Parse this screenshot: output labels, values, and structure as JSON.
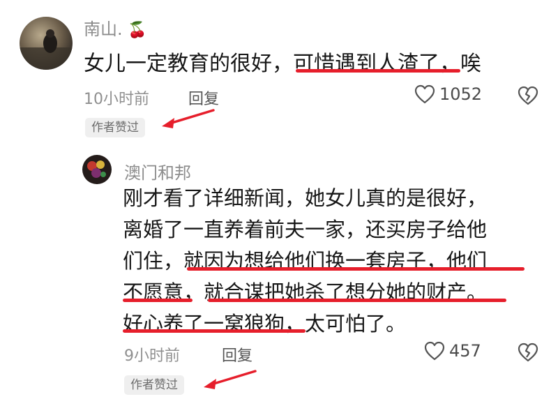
{
  "comment": {
    "author": "南山.",
    "author_emoji": "🍒",
    "text": "女儿一定教育的很好，可惜遇到人渣了，唉",
    "time": "10小时前",
    "reply_label": "回复",
    "likes": "1052",
    "badge": "作者赞过"
  },
  "reply": {
    "author": "澳门和邦",
    "lines": [
      "刚才看了详细新闻，她女儿真的是很好，",
      "离婚了一直养着前夫一家，还买房子给他",
      "们住，就因为想给他们换一套房子，他们",
      "不愿意，就合谋把她杀了想分她的财产。",
      "好心养了一窝狼狗，太可怕了。"
    ],
    "time": "9小时前",
    "reply_label": "回复",
    "likes": "457",
    "badge": "作者赞过"
  },
  "icons": {
    "like": "heart-outline-icon",
    "dislike": "broken-heart-icon",
    "annotation": "red-arrow-icon"
  },
  "colors": {
    "highlight": "#e61e2b",
    "badge_bg": "#efefef",
    "meta_text": "#8f8f8f"
  }
}
